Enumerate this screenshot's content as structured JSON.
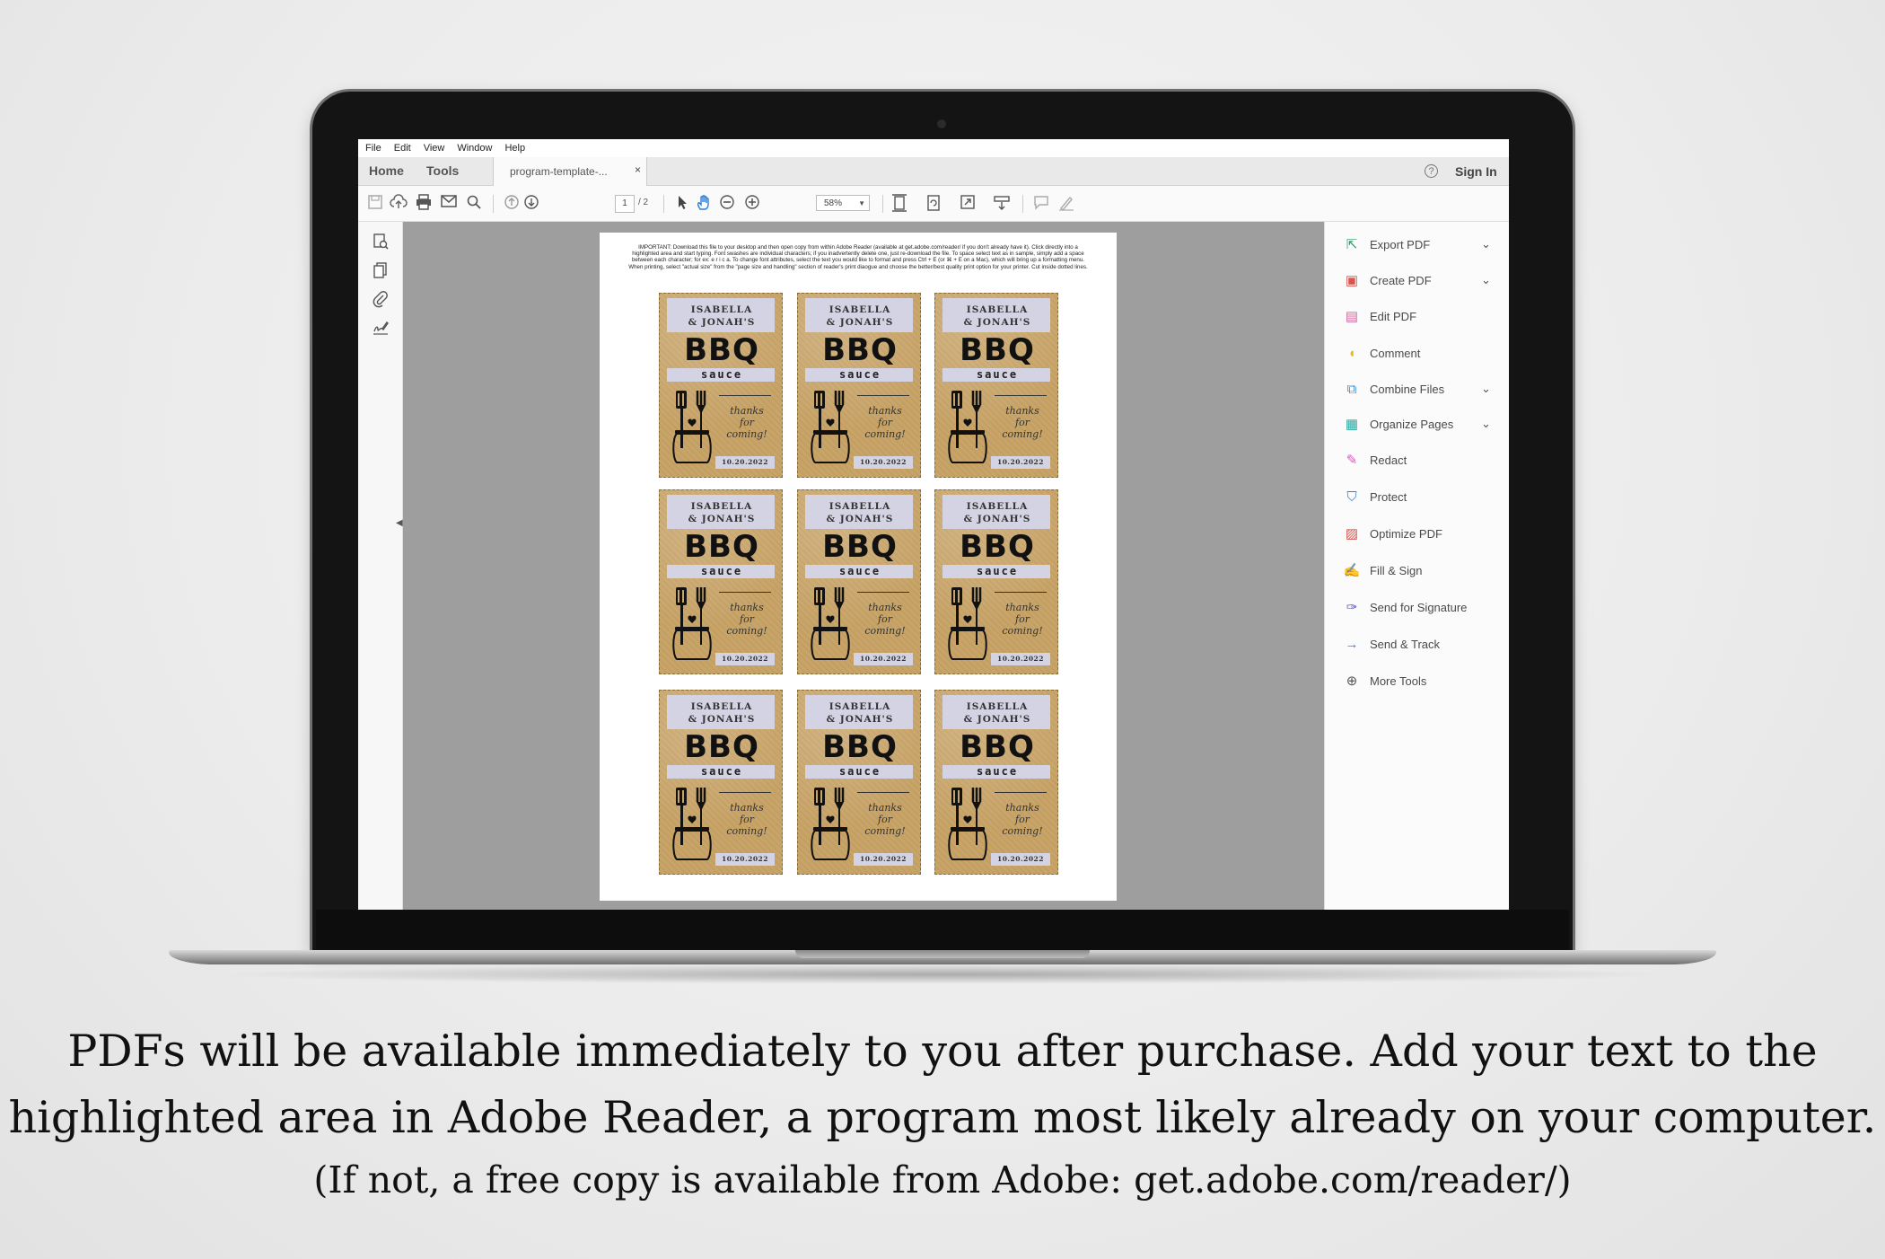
{
  "menubar": {
    "items": [
      "File",
      "Edit",
      "View",
      "Window",
      "Help"
    ]
  },
  "tabs": {
    "home": "Home",
    "tools": "Tools",
    "document": "program-template-...",
    "close": "×"
  },
  "account": {
    "help": "?",
    "sign_in": "Sign In"
  },
  "toolbar": {
    "icons": [
      "save-icon",
      "upload-icon",
      "print-icon",
      "email-icon",
      "search-icon",
      "page-up-icon",
      "page-down-icon",
      "select-icon",
      "hand-icon",
      "zoom-out-icon",
      "zoom-in-icon",
      "fit-page-icon",
      "rotate-icon",
      "full-screen-icon",
      "scroll-icon",
      "comment-icon",
      "sign-icon"
    ],
    "page_current": "1",
    "page_total": "/ 2",
    "zoom": "58%"
  },
  "left_rail": {
    "icons": [
      "page-thumbnails-icon",
      "copy-pages-icon",
      "attachment-icon",
      "signature-icon"
    ]
  },
  "document": {
    "instructions": "IMPORTANT: Download this file to your desktop and then open copy from within Adobe Reader (available at get.adobe.com/reader/ if you don't already have it). Click directly into a highlighted area and start typing. Font swashes are individual characters; if you inadvertently delete one, just re-download the file. To space select text as in sample, simply add a space between each character; for ex: e r i c a. To change font attributes, select the text you would like to format and press Ctrl + E (or ⌘ + E on a Mac), which will bring up a formatting menu. When printing, select \"actual size\" from the \"page size and handling\" section of reader's print diaogue and choose the better/best quality print option for your printer. Cut inside dotted lines.",
    "label": {
      "name_line1": "ISABELLA",
      "name_line2": "& JONAH'S",
      "title": "BBQ",
      "subtitle": "sauce",
      "thanks_line1": "thanks",
      "thanks_line2": "for",
      "thanks_line3": "coming!",
      "date": "10.20.2022",
      "count": 9
    }
  },
  "tools_panel": {
    "items": [
      {
        "label": "Export PDF",
        "icon": "export-pdf-icon",
        "color": "#2e9b6a",
        "chevron": true
      },
      {
        "label": "Create PDF",
        "icon": "create-pdf-icon",
        "color": "#d9534f",
        "chevron": true
      },
      {
        "label": "Edit PDF",
        "icon": "edit-pdf-icon",
        "color": "#d46aa0",
        "chevron": false
      },
      {
        "label": "Comment",
        "icon": "comment-icon",
        "color": "#e8b820",
        "chevron": false
      },
      {
        "label": "Combine Files",
        "icon": "combine-files-icon",
        "color": "#3b8fd9",
        "chevron": true
      },
      {
        "label": "Organize Pages",
        "icon": "organize-pages-icon",
        "color": "#2ea7a0",
        "chevron": true
      },
      {
        "label": "Redact",
        "icon": "redact-icon",
        "color": "#d65ab6",
        "chevron": false
      },
      {
        "label": "Protect",
        "icon": "protect-icon",
        "color": "#3b7fd9",
        "chevron": false
      },
      {
        "label": "Optimize PDF",
        "icon": "optimize-pdf-icon",
        "color": "#d9534f",
        "chevron": false
      },
      {
        "label": "Fill & Sign",
        "icon": "fill-sign-icon",
        "color": "#6a5acd",
        "chevron": false
      },
      {
        "label": "Send for Signature",
        "icon": "send-signature-icon",
        "color": "#5a5acd",
        "chevron": false
      },
      {
        "label": "Send & Track",
        "icon": "send-track-icon",
        "color": "#3b7fd9",
        "chevron": false
      },
      {
        "label": "More Tools",
        "icon": "more-tools-icon",
        "color": "#555555",
        "chevron": false
      }
    ]
  },
  "caption": {
    "line1": "PDFs will be available immediately to you after purchase.  Add your text to the",
    "line2": "highlighted area in Adobe Reader, a program most likely already on your computer.",
    "line3": "(If not, a free copy is available from Adobe: get.adobe.com/reader/)"
  }
}
